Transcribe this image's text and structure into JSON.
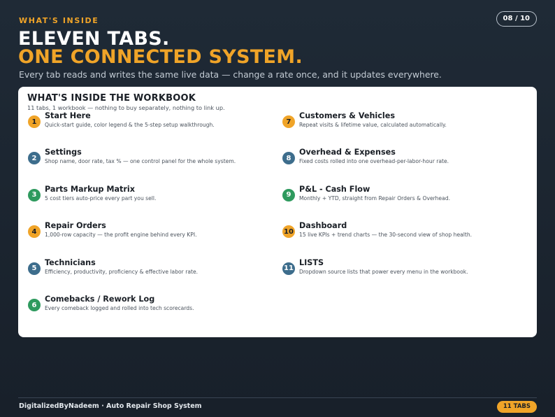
{
  "header": {
    "eyebrow": "WHAT'S INSIDE",
    "page_indicator": "08 / 10",
    "title_line1": "ELEVEN TABS.",
    "title_line2": "ONE CONNECTED SYSTEM.",
    "subtitle": "Every tab reads and writes the same live data — change a rate once, and it updates everywhere."
  },
  "card": {
    "title": "WHAT'S INSIDE THE WORKBOOK",
    "subtitle": "11 tabs, 1 workbook — nothing to buy separately, nothing to link up.",
    "items": [
      {
        "num": "1",
        "title": "Start Here",
        "desc": "Quick-start guide, color legend & the 5-step setup walkthrough.",
        "color": "#f0a428"
      },
      {
        "num": "2",
        "title": "Settings",
        "desc": "Shop name, door rate, tax % — one control panel for the whole system.",
        "color": "#3d6d8c"
      },
      {
        "num": "3",
        "title": "Parts Markup Matrix",
        "desc": "5 cost tiers auto-price every part you sell.",
        "color": "#2e9a5e"
      },
      {
        "num": "4",
        "title": "Repair Orders",
        "desc": "1,000-row capacity — the profit engine behind every KPI.",
        "color": "#f0a428"
      },
      {
        "num": "5",
        "title": "Technicians",
        "desc": "Efficiency, productivity, proficiency & effective labor rate.",
        "color": "#3d6d8c"
      },
      {
        "num": "6",
        "title": "Comebacks / Rework Log",
        "desc": "Every comeback logged and rolled into tech scorecards.",
        "color": "#2e9a5e"
      },
      {
        "num": "7",
        "title": "Customers & Vehicles",
        "desc": "Repeat visits & lifetime value, calculated automatically.",
        "color": "#f0a428"
      },
      {
        "num": "8",
        "title": "Overhead & Expenses",
        "desc": "Fixed costs rolled into one overhead-per-labor-hour rate.",
        "color": "#3d6d8c"
      },
      {
        "num": "9",
        "title": "P&L - Cash Flow",
        "desc": "Monthly + YTD, straight from Repair Orders & Overhead.",
        "color": "#2e9a5e"
      },
      {
        "num": "10",
        "title": "Dashboard",
        "desc": "15 live KPIs + trend charts — the 30-second view of shop health.",
        "color": "#f0a428"
      },
      {
        "num": "11",
        "title": "LISTS",
        "desc": "Dropdown source lists that power every menu in the workbook.",
        "color": "#3d6d8c"
      }
    ]
  },
  "footer": {
    "text": "DigitalizedByNadeem  ·  Auto Repair Shop System",
    "badge": "11 TABS"
  }
}
